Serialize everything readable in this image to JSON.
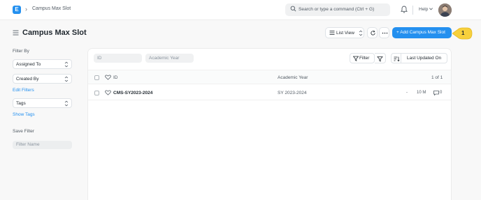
{
  "navbar": {
    "breadcrumb": "Campus Max Slot",
    "search_placeholder": "Search or type a command (Ctrl + G)",
    "help_label": "Help"
  },
  "header": {
    "title": "Campus Max Slot",
    "list_view_label": "List View",
    "add_button_label": "+ Add Campus Max Slot",
    "callout_number": "1"
  },
  "sidebar": {
    "filter_by_label": "Filter By",
    "assigned_to": "Assigned To",
    "created_by": "Created By",
    "edit_filters": "Edit Filters",
    "tags": "Tags",
    "show_tags": "Show Tags",
    "save_filter_label": "Save Filter",
    "filter_name_placeholder": "Filter Name"
  },
  "list": {
    "id_placeholder": "ID",
    "academic_year_placeholder": "Academic Year",
    "filter_label": "Filter",
    "sort_label": "Last Updated On",
    "columns": {
      "id": "ID",
      "academic_year": "Academic Year",
      "count": "1 of 1"
    },
    "rows": [
      {
        "id": "CMS-SY2023-2024",
        "academic_year": "SY 2023-2024",
        "dash": "-",
        "modified": "10 M",
        "comments": "0"
      }
    ]
  },
  "colors": {
    "primary": "#2490ef",
    "callout": "#f7d03c"
  }
}
